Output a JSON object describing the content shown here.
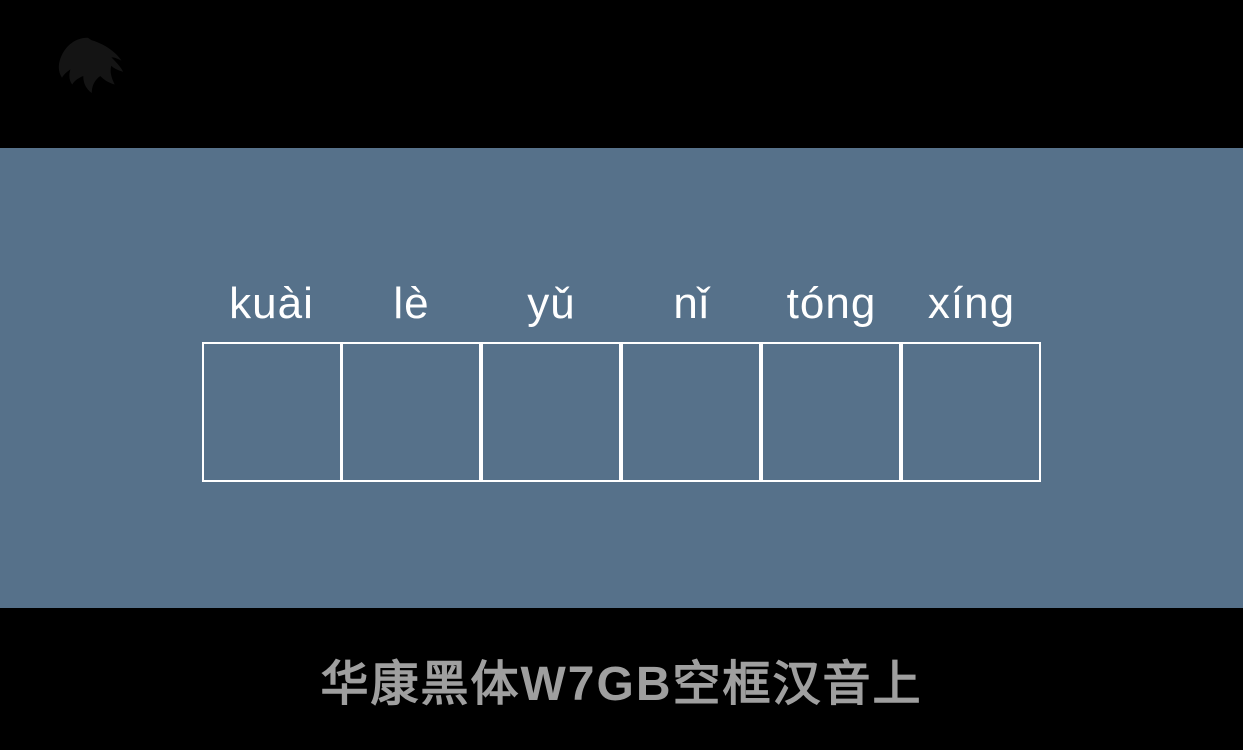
{
  "font_name": "华康黑体W7GB空框汉音上",
  "chars": [
    {
      "pinyin": "kuài"
    },
    {
      "pinyin": "lè"
    },
    {
      "pinyin": "yǔ"
    },
    {
      "pinyin": "nǐ"
    },
    {
      "pinyin": "tóng"
    },
    {
      "pinyin": "xíng"
    }
  ]
}
